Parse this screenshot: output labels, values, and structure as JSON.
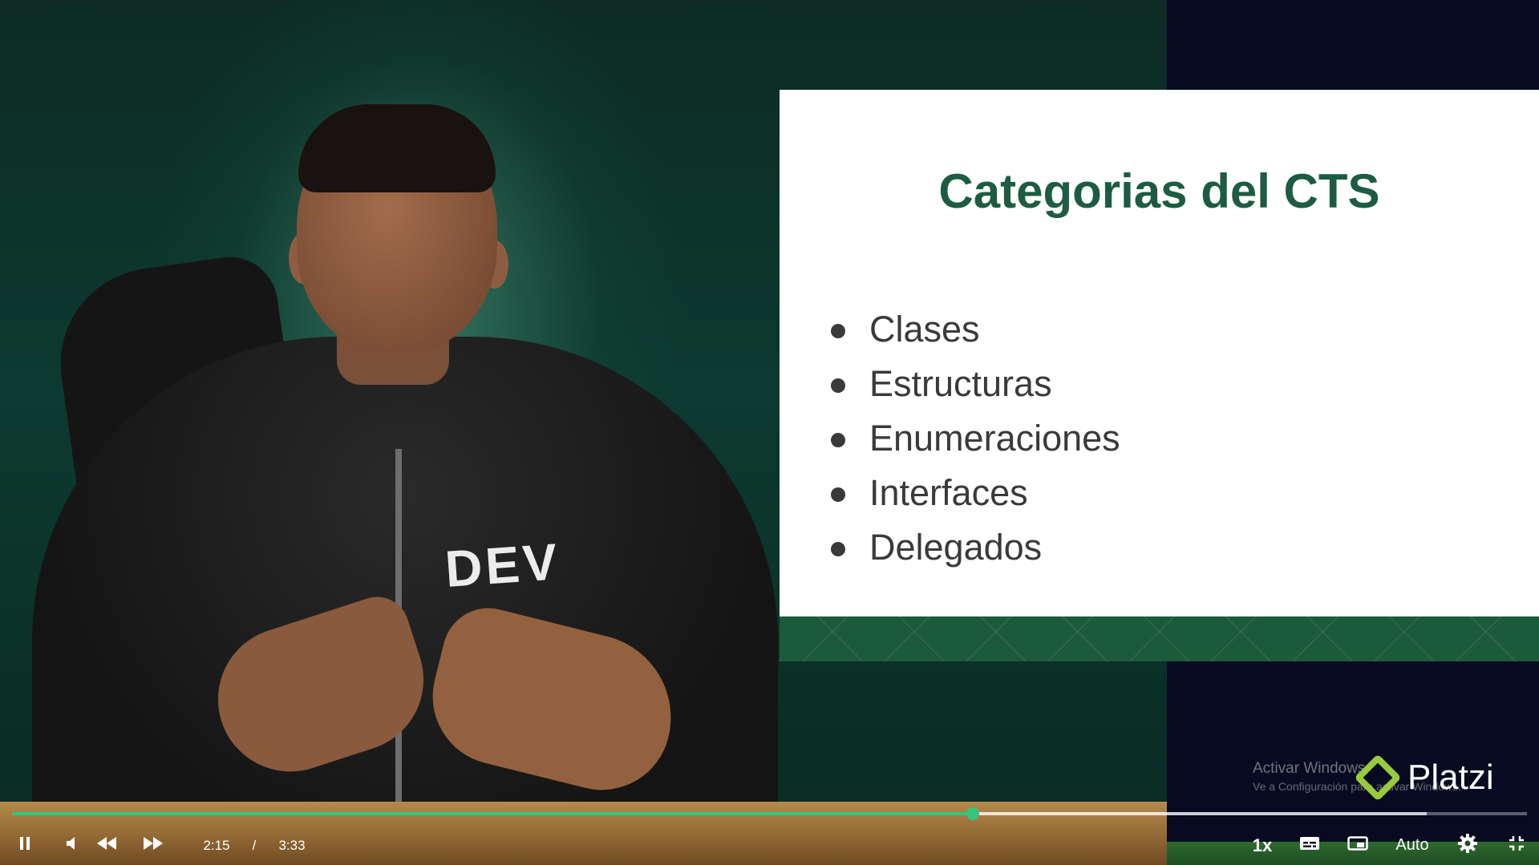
{
  "slide": {
    "title": "Categorias del CTS",
    "items": [
      "Clases",
      "Estructuras",
      "Enumeraciones",
      "Interfaces",
      "Delegados"
    ]
  },
  "presenter": {
    "shirt_text": "DEV"
  },
  "watermark": {
    "activate_title": "Activar Windows",
    "activate_sub": "Ve a Configuración para activar Windows.",
    "brand": "Platzi"
  },
  "player": {
    "current_time": "2:15",
    "separator": "/",
    "duration": "3:33",
    "progress_fraction": 0.634,
    "buffered_fraction": 0.934,
    "speed_label": "1x",
    "quality_label": "Auto",
    "accent_color": "#33c67e",
    "icons": [
      "pause-icon",
      "volume-icon",
      "rewind-icon",
      "forward-icon",
      "captions-icon",
      "pip-icon",
      "settings-icon",
      "exit-fullscreen-icon"
    ]
  }
}
